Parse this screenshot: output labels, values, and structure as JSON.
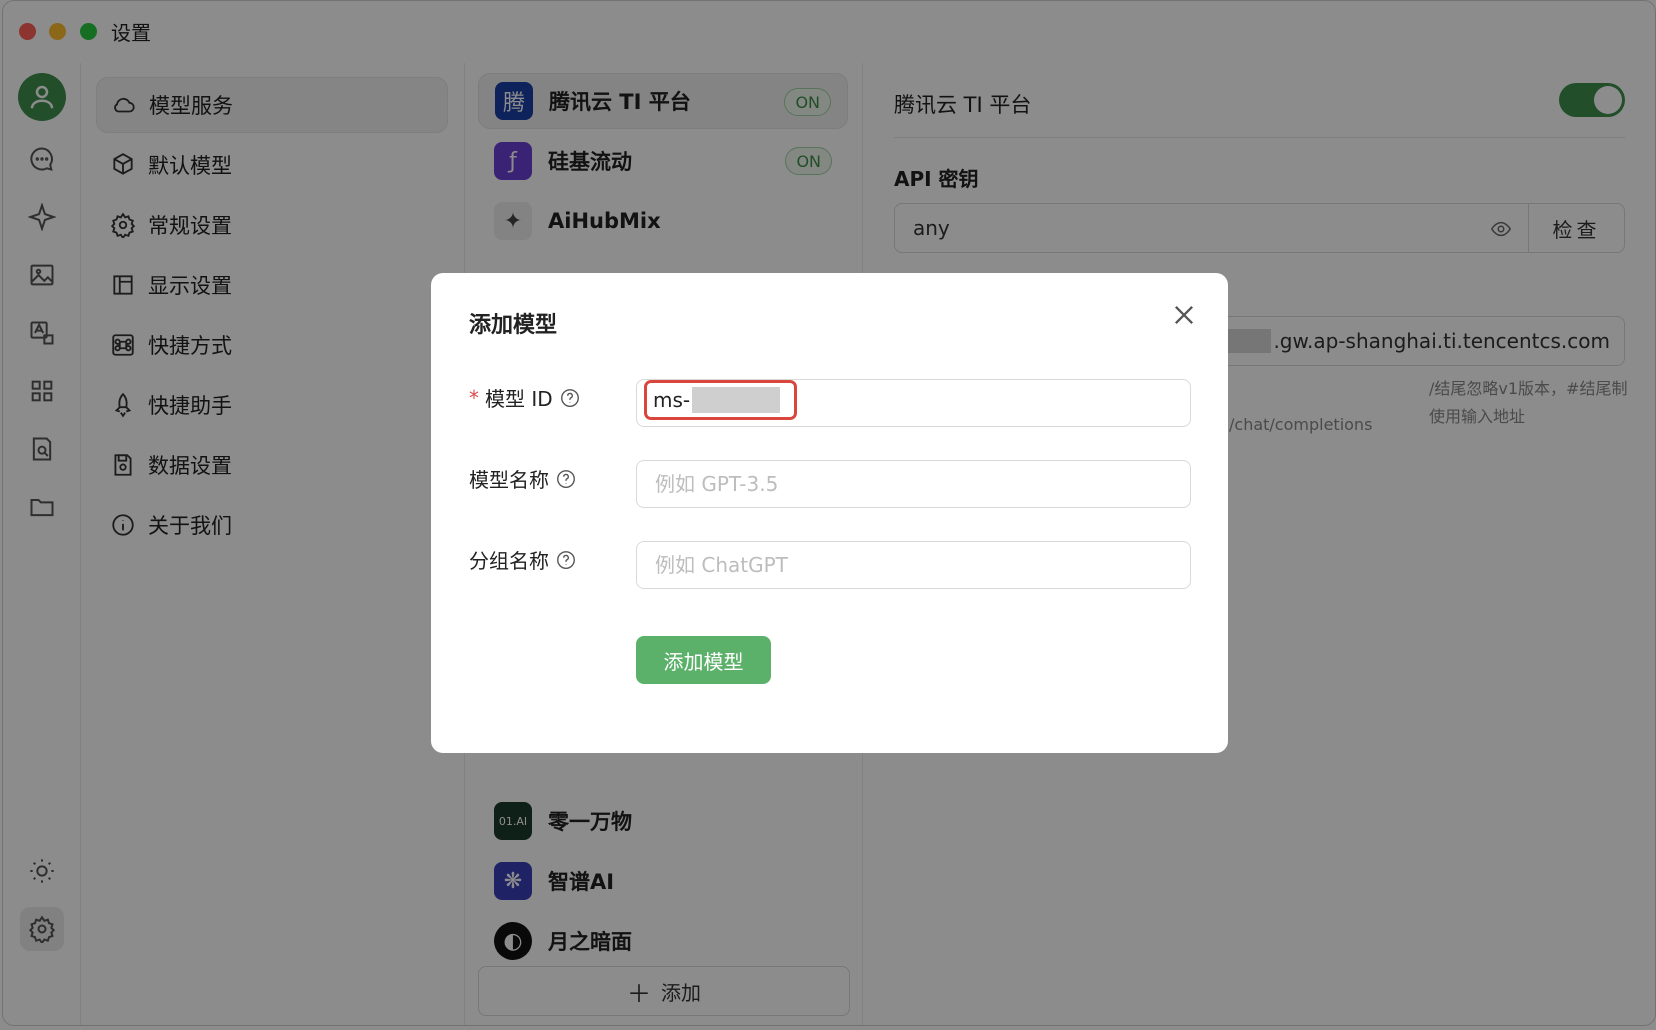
{
  "window": {
    "title": "设置"
  },
  "menu": {
    "items": [
      {
        "label": "模型服务",
        "icon": "cloud-icon",
        "active": true
      },
      {
        "label": "默认模型",
        "icon": "cube-icon"
      },
      {
        "label": "常规设置",
        "icon": "gear-icon"
      },
      {
        "label": "显示设置",
        "icon": "layout-icon"
      },
      {
        "label": "快捷方式",
        "icon": "command-icon"
      },
      {
        "label": "快捷助手",
        "icon": "rocket-icon"
      },
      {
        "label": "数据设置",
        "icon": "save-icon"
      },
      {
        "label": "关于我们",
        "icon": "info-icon"
      }
    ]
  },
  "providers": {
    "items": [
      {
        "name": "腾讯云 TI 平台",
        "logo": "腾",
        "badge": "ON",
        "color": "#1a3ea8"
      },
      {
        "name": "硅基流动",
        "logo": "ƒ",
        "badge": "ON",
        "color": "#6b3fd6"
      },
      {
        "name": "AiHubMix",
        "logo": "✦",
        "color": "#e8e8e8"
      },
      {
        "name": "零一万物",
        "logo": "01.AI",
        "color": "#1c3b2c"
      },
      {
        "name": "智谱AI",
        "logo": "❋",
        "color": "#3a3fb8"
      },
      {
        "name": "月之暗面",
        "logo": "◐",
        "color": "#111111"
      }
    ],
    "add_label": "添加"
  },
  "detail": {
    "title": "腾讯云 TI 平台",
    "api_key_label": "API 密钥",
    "api_key_value": "any",
    "check_label": "检查",
    "url_value": ".gw.ap-shanghai.ti.tencentcs.com",
    "hint_endpoint": "/chat/completions",
    "hint_note": "/结尾忽略v1版本，#结尾制使用输入地址"
  },
  "modal": {
    "title": "添加模型",
    "model_id_label": "模型 ID",
    "model_id_value": "ms-",
    "model_name_label": "模型名称",
    "model_name_placeholder": "例如 GPT-3.5",
    "group_name_label": "分组名称",
    "group_name_placeholder": "例如 ChatGPT",
    "submit_label": "添加模型"
  },
  "colors": {
    "accent": "#3f8e4d",
    "primary_button": "#5bb06a",
    "highlight": "#d9473c"
  }
}
